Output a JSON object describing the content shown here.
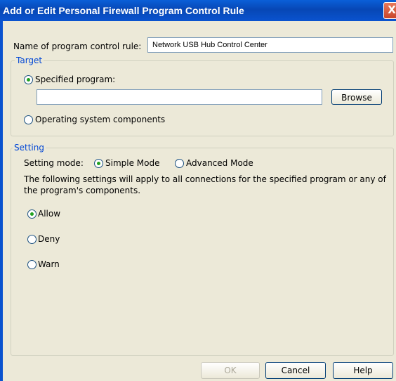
{
  "window": {
    "title": "Add or Edit Personal Firewall Program Control Rule",
    "close_glyph": "X"
  },
  "rule_name": {
    "label": "Name of program control rule:",
    "value": "Network USB Hub Control Center"
  },
  "target": {
    "legend": "Target",
    "specified_program_label": "Specified program:",
    "specified_program_selected": true,
    "program_path_value": "",
    "browse_label": "Browse",
    "os_components_label": "Operating system components"
  },
  "setting": {
    "legend": "Setting",
    "mode_label": "Setting mode:",
    "simple_mode_label": "Simple Mode",
    "advanced_mode_label": "Advanced Mode",
    "selected_mode": "Simple Mode",
    "description": "The following settings will apply to all connections for the specified program or any of the program's components.",
    "allow_label": "Allow",
    "deny_label": "Deny",
    "warn_label": "Warn",
    "selected_action": "Allow"
  },
  "buttons": {
    "ok_label": "OK",
    "cancel_label": "Cancel",
    "help_label": "Help"
  },
  "colors": {
    "title_bar": "#0747b5",
    "dialog_background": "#ece9d8",
    "legend_text": "#0046d5",
    "radio_dot": "#21a121"
  }
}
